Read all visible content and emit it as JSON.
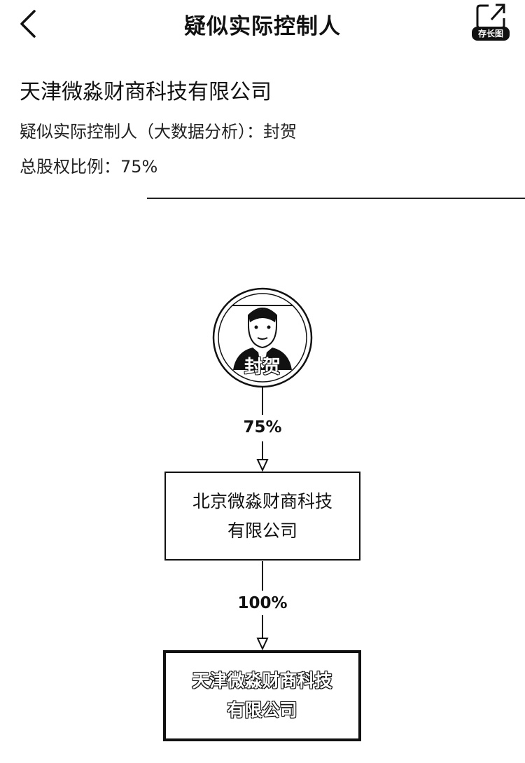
{
  "nav": {
    "title": "疑似实际控制人",
    "save_label": "存长图"
  },
  "company": {
    "name": "天津微淼财商科技有限公司",
    "controller_line": "疑似实际控制人（大数据分析）：封贺",
    "equity_line": "总股权比例：75%"
  },
  "chart": {
    "person_name": "封贺",
    "edges": [
      {
        "percent": "75%"
      },
      {
        "percent": "100%"
      }
    ],
    "intermediate": {
      "line1": "北京微淼财商科技",
      "line2": "有限公司"
    },
    "target": {
      "line1": "天津微淼财商科技",
      "line2": "有限公司"
    }
  },
  "icons": {
    "back": "chevron-left-icon",
    "save": "share-icon",
    "avatar": "person-avatar-icon"
  },
  "colors": {
    "text": "#111111",
    "background": "#ffffff"
  }
}
